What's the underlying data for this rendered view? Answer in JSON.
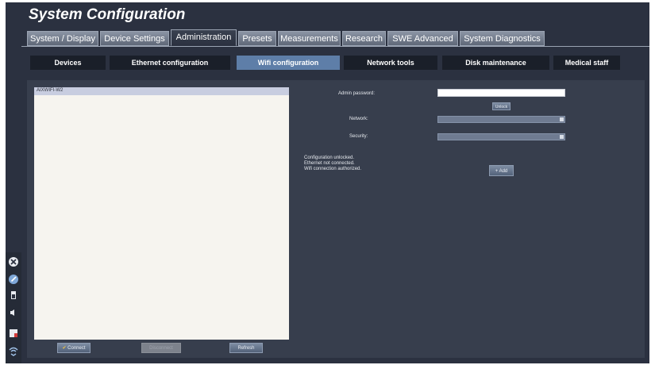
{
  "window": {
    "title": "System Configuration"
  },
  "tabs": [
    {
      "label": "System / Display"
    },
    {
      "label": "Device Settings"
    },
    {
      "label": "Administration",
      "active": true
    },
    {
      "label": "Presets"
    },
    {
      "label": "Measurements"
    },
    {
      "label": "Research"
    },
    {
      "label": "SWE Advanced"
    },
    {
      "label": "System Diagnostics"
    }
  ],
  "subtabs": [
    {
      "label": "Devices"
    },
    {
      "label": "Ethernet configuration"
    },
    {
      "label": "Wifi configuration",
      "active": true
    },
    {
      "label": "Network tools"
    },
    {
      "label": "Disk maintenance"
    },
    {
      "label": "Medical staff"
    }
  ],
  "wifi_list": {
    "items": [
      "AIXWIFI-W2"
    ]
  },
  "buttons": {
    "connect": "Connect",
    "disconnect": "Disconnect",
    "refresh": "Refresh",
    "unlock": "Unlock",
    "add": "Add"
  },
  "form": {
    "admin_password_label": "Admin password:",
    "admin_password_value": "",
    "network_label": "Network:",
    "network_value": "",
    "security_label": "Security:",
    "security_value": ""
  },
  "status": {
    "lines": [
      "Configuration unlocked.",
      "Ethernet not connected.",
      "Wifi connection authorized."
    ]
  },
  "colors": {
    "background": "#2b3140",
    "panel": "#373e4d",
    "active_subtab": "#5e7ea8",
    "subtab": "#1a1f29",
    "list_bg": "#f6f4ef"
  },
  "left_toolbar": {
    "icons": [
      "close-circle-icon",
      "wrench-icon",
      "battery-icon",
      "speaker-icon",
      "patient-card-icon",
      "wifi-icon"
    ]
  }
}
